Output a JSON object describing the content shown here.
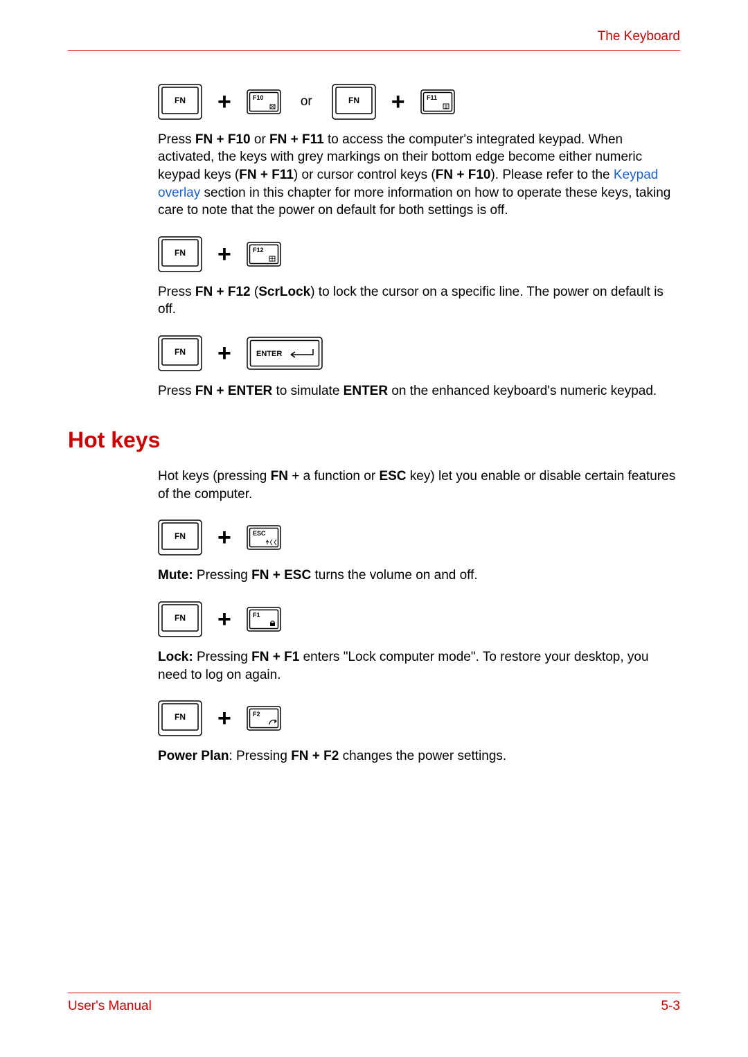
{
  "header": {
    "title": "The Keyboard"
  },
  "footer": {
    "left": "User's Manual",
    "right": "5-3"
  },
  "keys": {
    "fn": "FN",
    "f10": "F10",
    "f11": "F11",
    "f12": "F12",
    "esc": "ESC",
    "f1": "F1",
    "f2": "F2",
    "enter": "ENTER"
  },
  "misc": {
    "or": "or",
    "plus": "+"
  },
  "para": {
    "p1a": "Press ",
    "p1b": "FN + F10",
    "p1c": " or ",
    "p1d": "FN + F11",
    "p1e": " to access the computer's integrated keypad. When activated, the keys with grey markings on their bottom edge become either numeric keypad keys (",
    "p1f": "FN + F11",
    "p1g": ") or cursor control keys (",
    "p1h": "FN + F10",
    "p1i": "). Please refer to the ",
    "p1j": "Keypad overlay",
    "p1k": " section in this chapter for more information on how to operate these keys, taking care to note that the power on default for both settings is off.",
    "p2a": "Press ",
    "p2b": "FN + F12",
    "p2c": " (",
    "p2d": "ScrLock",
    "p2e": ") to lock the cursor on a specific line. The power on default is off.",
    "p3a": "Press ",
    "p3b": "FN + ENTER",
    "p3c": " to simulate ",
    "p3d": "ENTER",
    "p3e": " on the enhanced keyboard's numeric keypad.",
    "h2": "Hot keys",
    "p4a": "Hot keys (pressing ",
    "p4b": "FN",
    "p4c": " + a function or ",
    "p4d": "ESC",
    "p4e": " key) let you enable or disable certain features of the computer.",
    "p5a": "Mute:",
    "p5b": " Pressing ",
    "p5c": "FN + ESC",
    "p5d": " turns the volume on and off.",
    "p6a": "Lock:",
    "p6b": " Pressing ",
    "p6c": "FN + F1",
    "p6d": " enters \"Lock computer mode\". To restore your desktop, you need to log on again.",
    "p7a": "Power Plan",
    "p7b": ": Pressing ",
    "p7c": "FN + F2",
    "p7d": " changes the power settings."
  }
}
